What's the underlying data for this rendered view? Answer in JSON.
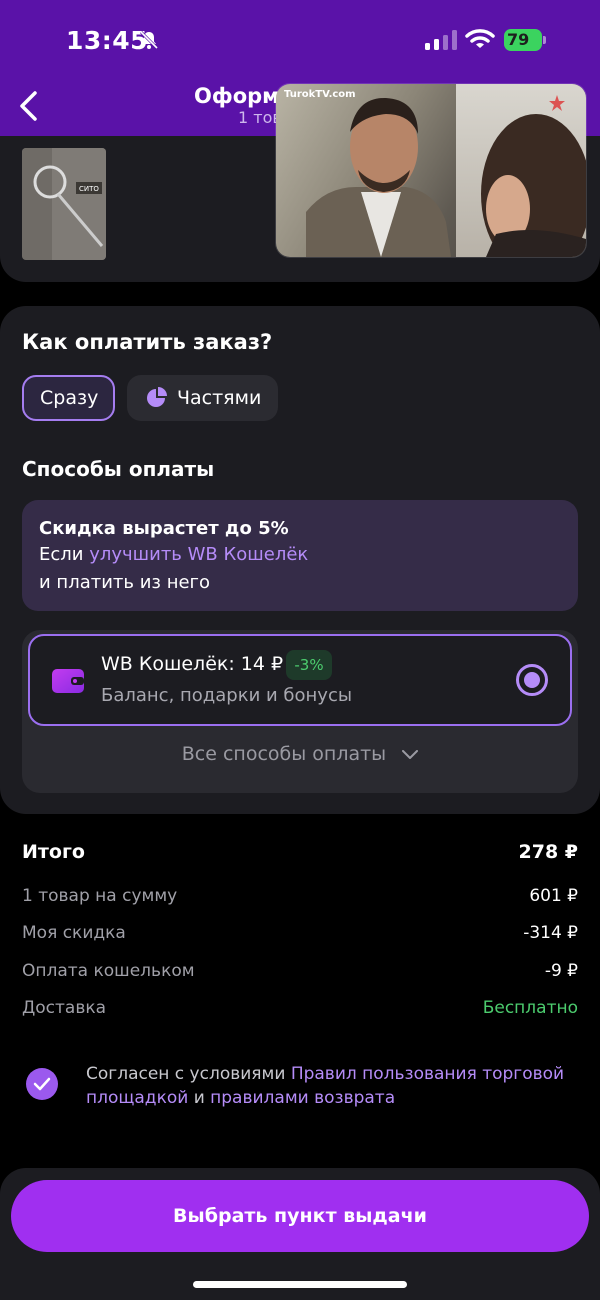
{
  "status_bar": {
    "time": "13:45",
    "battery": "79"
  },
  "header": {
    "title": "Оформл",
    "subtitle": "1 тов"
  },
  "video": {
    "logo": "TurokTV.com"
  },
  "product": {
    "thumb_text": "СИТО"
  },
  "payment": {
    "heading": "Как оплатить заказ?",
    "tabs": [
      {
        "label": "Сразу",
        "active": true
      },
      {
        "label": "Частями",
        "active": false
      }
    ],
    "methods_heading": "Способы оплаты",
    "promo": {
      "title": "Скидка вырастет до 5%",
      "line1_prefix": "Если ",
      "line1_link": "улучшить WB Кошелёк",
      "line2": "и платить из него"
    },
    "wallet": {
      "name": "WB Кошелёк: 14 ₽",
      "badge": "-3%",
      "description": "Баланс, подарки и бонусы",
      "selected": true
    },
    "all_methods": "Все способы оплаты"
  },
  "summary": {
    "total_label": "Итого",
    "total_value": "278 ₽",
    "rows": [
      {
        "label": "1 товар на сумму",
        "value": "601 ₽"
      },
      {
        "label": "Моя скидка",
        "value": "-314 ₽"
      },
      {
        "label": "Оплата кошельком",
        "value": "-9 ₽"
      },
      {
        "label": "Доставка",
        "value": "Бесплатно"
      }
    ]
  },
  "agreement": {
    "prefix": "Согласен с условиями ",
    "link1": "Правил пользования торговой площадкой",
    "middle": " и ",
    "link2": "правилами возврата"
  },
  "cta": {
    "label": "Выбрать пункт выдачи"
  },
  "colors": {
    "header": "#5a12a8",
    "accent": "#a02ff0",
    "link": "#b58cf8",
    "success": "#4ccc6e"
  }
}
